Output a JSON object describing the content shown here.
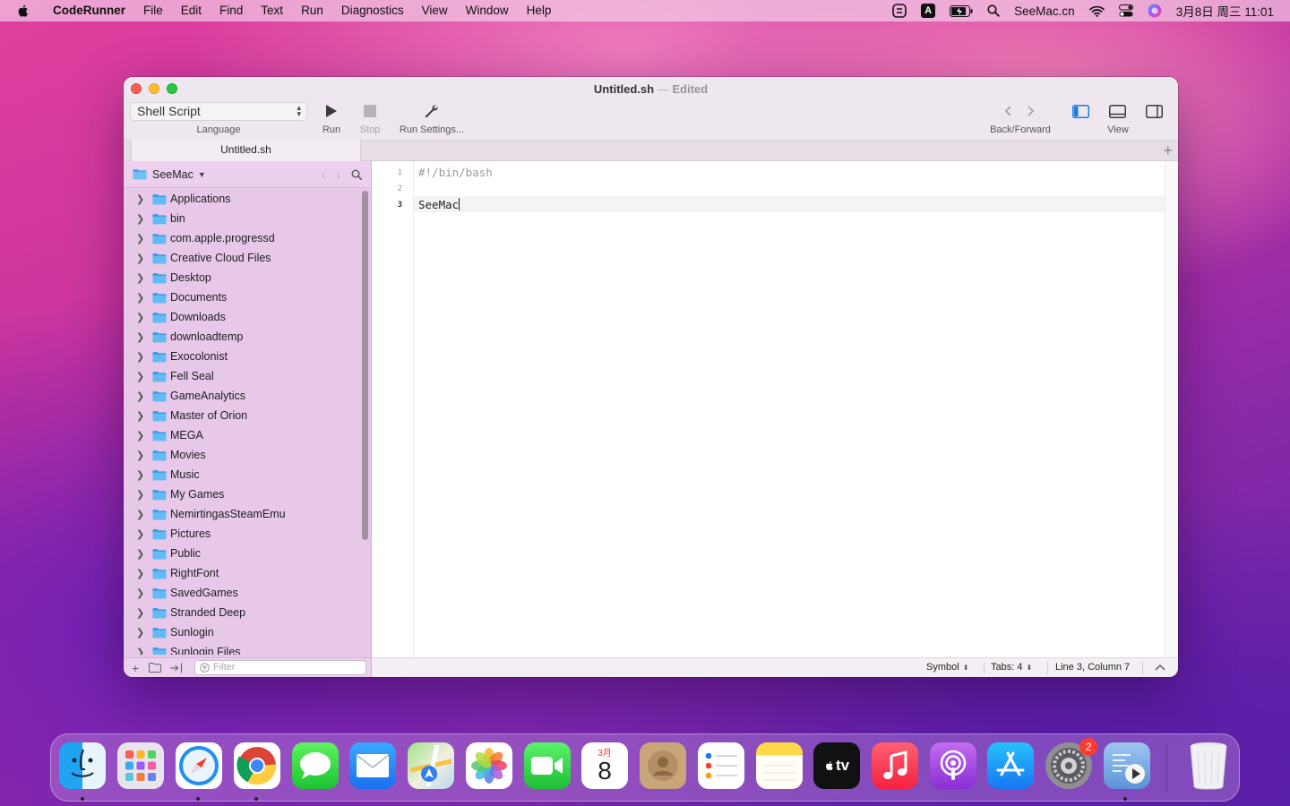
{
  "menubar": {
    "app_name": "CodeRunner",
    "items": [
      "File",
      "Edit",
      "Find",
      "Text",
      "Run",
      "Diagnostics",
      "View",
      "Window",
      "Help"
    ],
    "input_method": "A",
    "site_label": "SeeMac.cn",
    "clock": "3月8日 周三  11:01"
  },
  "window": {
    "title": "Untitled.sh",
    "title_sep": "—",
    "status": "Edited"
  },
  "toolbar": {
    "language_value": "Shell Script",
    "language_label": "Language",
    "run_label": "Run",
    "stop_label": "Stop",
    "run_settings_label": "Run Settings...",
    "back_forward_label": "Back/Forward",
    "view_label": "View"
  },
  "tabs": [
    {
      "label": "Untitled.sh",
      "active": true
    }
  ],
  "sidebar": {
    "folder_name": "SeeMac",
    "filter_placeholder": "Filter",
    "items": [
      "Applications",
      "bin",
      "com.apple.progressd",
      "Creative Cloud Files",
      "Desktop",
      "Documents",
      "Downloads",
      "downloadtemp",
      "Exocolonist",
      "Fell Seal",
      "GameAnalytics",
      "Master of Orion",
      "MEGA",
      "Movies",
      "Music",
      "My Games",
      "NemirtingasSteamEmu",
      "Pictures",
      "Public",
      "RightFont",
      "SavedGames",
      "Stranded Deep",
      "Sunlogin",
      "Sunlogin Files"
    ]
  },
  "editor": {
    "line_numbers": [
      "1",
      "2",
      "3"
    ],
    "lines": [
      "#!/bin/bash",
      "",
      "SeeMac"
    ],
    "current_line": 3
  },
  "statusbar": {
    "symbol": "Symbol",
    "tabs": "Tabs: 4",
    "position": "Line 3, Column 7"
  },
  "dock": {
    "apps": [
      "Finder",
      "Launchpad",
      "Safari",
      "Chrome",
      "Messages",
      "Mail",
      "Maps",
      "Photos",
      "FaceTime",
      "Calendar",
      "Contacts",
      "Reminders",
      "Notes",
      "Apple TV",
      "Music",
      "Podcasts",
      "App Store",
      "System Preferences",
      "CodeRunner",
      "Trash"
    ],
    "calendar_month": "3月",
    "calendar_day": "8",
    "system_prefs_badge": "2",
    "tv_label": "tv"
  },
  "colors": {
    "accent": "#1f7ae0",
    "sidebar_bg": "#e7c8e9",
    "folder_blue": "#5fb7f3"
  }
}
